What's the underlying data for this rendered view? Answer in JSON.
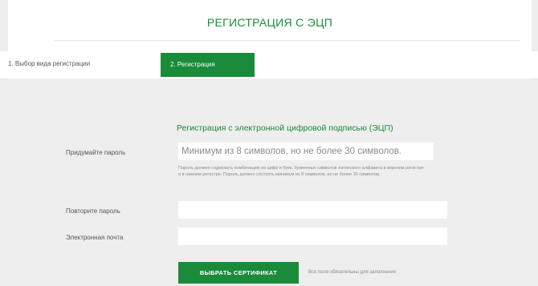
{
  "header": {
    "title": "РЕГИСТРАЦИЯ С ЭЦП"
  },
  "steps": {
    "step1": "1. Выбор вида регистрации",
    "step2": "2. Регистрация"
  },
  "form": {
    "heading": "Регистрация с электронной цифровой подписью (ЭЦП)",
    "password_label": "Придумайте пароль",
    "password_placeholder": "Минимум из 8 символов, но не более 30 символов.",
    "password_hint": "Пароль должен содержать комбинацию из цифр и букв, буквенных символов латинского алфавита в верхнем регистре и в нижнем регистре. Пароль должен состоять минимум из 8 символов, но не более 30 символов.",
    "repeat_label": "Повторите пароль",
    "email_label": "Электронная почта",
    "select_cert_button": "ВЫБРАТЬ СЕРТИФИКАТ",
    "cert_note": "Все поля обязательны для заполнения"
  },
  "colors": {
    "accent": "#1a8b3a",
    "background": "#eeeeee"
  }
}
